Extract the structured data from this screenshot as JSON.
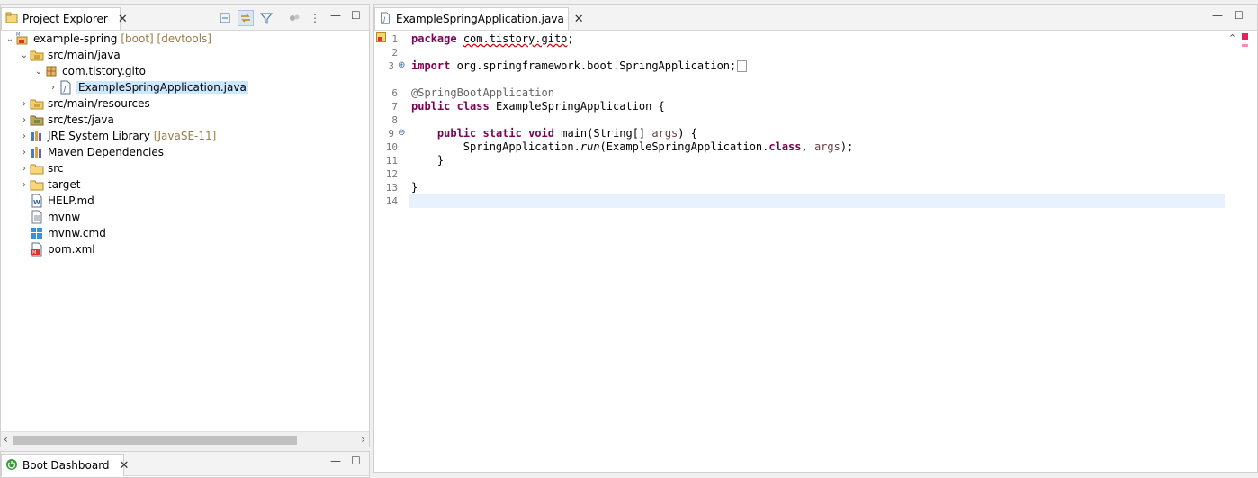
{
  "project_explorer": {
    "tab_label": "Project Explorer",
    "tree": [
      {
        "label": "example-spring",
        "decoration": "[boot] [devtools]",
        "icon": "spring-project-icon",
        "arrow": "v",
        "depth": 0
      },
      {
        "label": "src/main/java",
        "decoration": "",
        "icon": "source-folder-icon",
        "arrow": "v",
        "depth": 1
      },
      {
        "label": "com.tistory.gito",
        "decoration": "",
        "icon": "package-icon",
        "arrow": "v",
        "depth": 2
      },
      {
        "label": "ExampleSpringApplication.java",
        "decoration": "",
        "icon": "java-file-icon",
        "arrow": ">",
        "depth": 3,
        "selected": true
      },
      {
        "label": "src/main/resources",
        "decoration": "",
        "icon": "source-folder-icon",
        "arrow": ">",
        "depth": 1
      },
      {
        "label": "src/test/java",
        "decoration": "",
        "icon": "test-folder-icon",
        "arrow": ">",
        "depth": 1
      },
      {
        "label": "JRE System Library",
        "decoration": "[JavaSE-11]",
        "icon": "library-icon",
        "arrow": ">",
        "depth": 1
      },
      {
        "label": "Maven Dependencies",
        "decoration": "",
        "icon": "library-icon",
        "arrow": ">",
        "depth": 1
      },
      {
        "label": "src",
        "decoration": "",
        "icon": "folder-icon",
        "arrow": ">",
        "depth": 1
      },
      {
        "label": "target",
        "decoration": "",
        "icon": "folder-icon",
        "arrow": ">",
        "depth": 1
      },
      {
        "label": "HELP.md",
        "decoration": "",
        "icon": "markdown-file-icon",
        "arrow": "",
        "depth": 1
      },
      {
        "label": "mvnw",
        "decoration": "",
        "icon": "text-file-icon",
        "arrow": "",
        "depth": 1
      },
      {
        "label": "mvnw.cmd",
        "decoration": "",
        "icon": "windows-file-icon",
        "arrow": "",
        "depth": 1
      },
      {
        "label": "pom.xml",
        "decoration": "",
        "icon": "xml-file-icon",
        "arrow": "",
        "depth": 1
      }
    ]
  },
  "boot_dashboard": {
    "tab_label": "Boot Dashboard"
  },
  "editor": {
    "tab_label": "ExampleSpringApplication.java",
    "line_numbers": [
      "1",
      "2",
      "3",
      "6",
      "7",
      "8",
      "9",
      "10",
      "11",
      "12",
      "13",
      "14"
    ],
    "lines": {
      "l1_kw": "package",
      "l1_rest": "com.tistory.gito",
      "l1_end": ";",
      "l3_kw": "import",
      "l3_rest": " org.springframework.boot.SpringApplication;",
      "l6": "@SpringBootApplication",
      "l7_kw1": "public",
      "l7_kw2": "class",
      "l7_rest": " ExampleSpringApplication {",
      "l9_kw1": "public",
      "l9_kw2": "static",
      "l9_kw3": "void",
      "l9_rest1": " main(String[] ",
      "l9_param": "args",
      "l9_rest2": ") {",
      "l10_a": "SpringApplication.",
      "l10_run": "run",
      "l10_b": "(ExampleSpringApplication.",
      "l10_kw": "class",
      "l10_c": ", ",
      "l10_param": "args",
      "l10_d": ");",
      "l11": "}",
      "l13": "}"
    }
  },
  "colors": {
    "keyword": "#7f0055",
    "annotation": "#646464",
    "selection": "#cce8ff",
    "current_line": "#e8f2fe"
  }
}
